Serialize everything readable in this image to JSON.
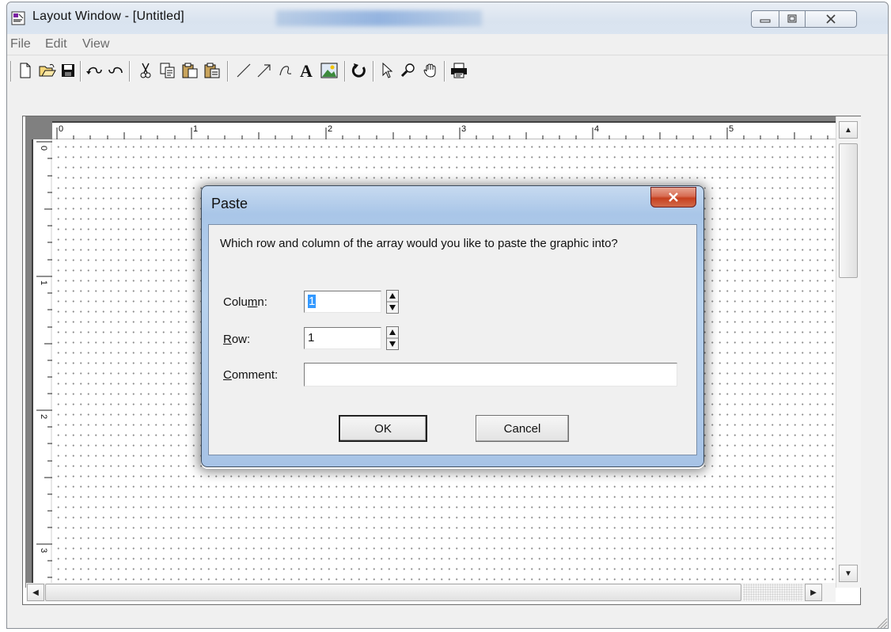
{
  "window": {
    "title": "Layout Window - [Untitled]",
    "caption_buttons": [
      "minimize",
      "restore",
      "close"
    ]
  },
  "menu": {
    "items": [
      "File",
      "Edit",
      "View"
    ]
  },
  "toolbar": {
    "icons": [
      "new-icon",
      "open-icon",
      "save-icon",
      "undo-icon",
      "redo-icon",
      "cut-icon",
      "copy-icon",
      "paste-icon",
      "paste-special-icon",
      "line-icon",
      "arrow-icon",
      "freeform-icon",
      "text-icon",
      "picture-icon",
      "rotate-icon",
      "pointer-icon",
      "zoom-icon",
      "pan-icon",
      "print-icon"
    ]
  },
  "rulers": {
    "horizontal_labels": [
      "0",
      "1",
      "2",
      "3",
      "4",
      "5"
    ],
    "vertical_labels": [
      "0",
      "1",
      "2",
      "3"
    ]
  },
  "dialog": {
    "title": "Paste",
    "close_label": "x",
    "question": "Which row and column of the array would you like to paste the graphic into?",
    "column_label_pre": "Colu",
    "column_label_u": "m",
    "column_label_post": "n:",
    "column_value": "1",
    "row_label_u": "R",
    "row_label_post": "ow:",
    "row_value": "1",
    "comment_label_u": "C",
    "comment_label_post": "omment:",
    "comment_value": "",
    "ok_label": "OK",
    "cancel_label": "Cancel"
  }
}
